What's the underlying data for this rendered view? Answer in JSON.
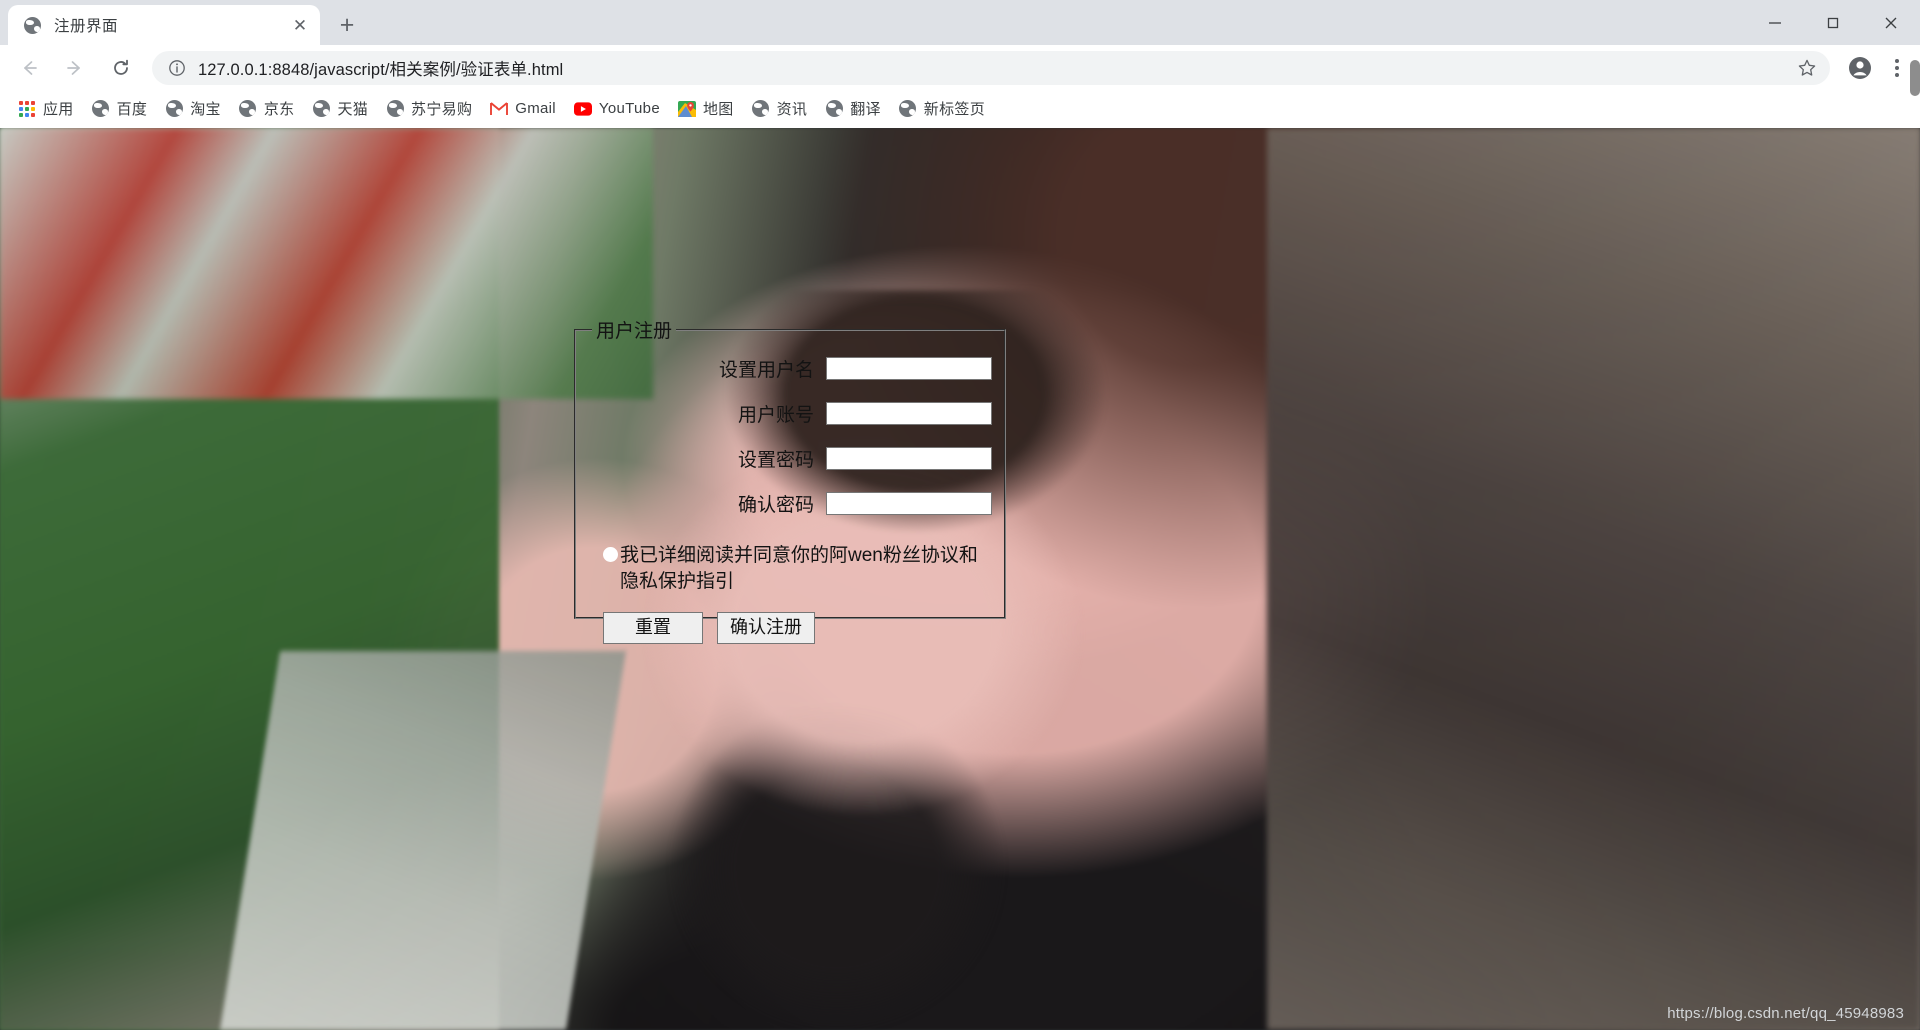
{
  "browser": {
    "tab": {
      "title": "注册界面",
      "favicon": "globe-icon",
      "close_label": "✕"
    },
    "new_tab_label": "+",
    "window_controls": {
      "minimize": "minimize-icon",
      "maximize": "maximize-icon",
      "close": "close-icon"
    },
    "toolbar": {
      "back": "back-arrow-icon",
      "forward": "forward-arrow-icon",
      "reload": "reload-icon",
      "site_info": "info-circle-icon",
      "url": "127.0.0.1:8848/javascript/相关案例/验证表单.html",
      "bookmark_star": "star-icon",
      "profile": "profile-avatar-icon",
      "menu": "three-dot-menu-icon"
    },
    "bookmarks": [
      {
        "label": "应用",
        "icon": "apps-grid-icon"
      },
      {
        "label": "百度",
        "icon": "globe-icon"
      },
      {
        "label": "淘宝",
        "icon": "globe-icon"
      },
      {
        "label": "京东",
        "icon": "globe-icon"
      },
      {
        "label": "天猫",
        "icon": "globe-icon"
      },
      {
        "label": "苏宁易购",
        "icon": "globe-icon"
      },
      {
        "label": "Gmail",
        "icon": "gmail-icon"
      },
      {
        "label": "YouTube",
        "icon": "youtube-icon"
      },
      {
        "label": "地图",
        "icon": "maps-pin-icon"
      },
      {
        "label": "资讯",
        "icon": "globe-icon"
      },
      {
        "label": "翻译",
        "icon": "globe-icon"
      },
      {
        "label": "新标签页",
        "icon": "globe-icon"
      }
    ]
  },
  "page": {
    "form": {
      "legend": "用户注册",
      "fields": [
        {
          "label": "设置用户名",
          "value": "",
          "placeholder": "",
          "type": "text"
        },
        {
          "label": "用户账号",
          "value": "",
          "placeholder": "",
          "type": "text"
        },
        {
          "label": "设置密码",
          "value": "",
          "placeholder": "",
          "type": "password"
        },
        {
          "label": "确认密码",
          "value": "",
          "placeholder": "",
          "type": "password"
        }
      ],
      "agreement": {
        "checked": false,
        "text": "我已详细阅读并同意你的阿wen粉丝协议和隐私保护指引"
      },
      "buttons": {
        "reset": "重置",
        "submit": "确认注册"
      }
    },
    "watermark": "https://blog.csdn.net/qq_45948983"
  },
  "colors": {
    "titlebar": "#dee1e6",
    "tab_active": "#ffffff",
    "omnibox": "#f1f3f4",
    "form_border": "#7f7f7f",
    "button_face": "#efefef",
    "text": "#131313",
    "watermark": "#d2d5d8"
  }
}
